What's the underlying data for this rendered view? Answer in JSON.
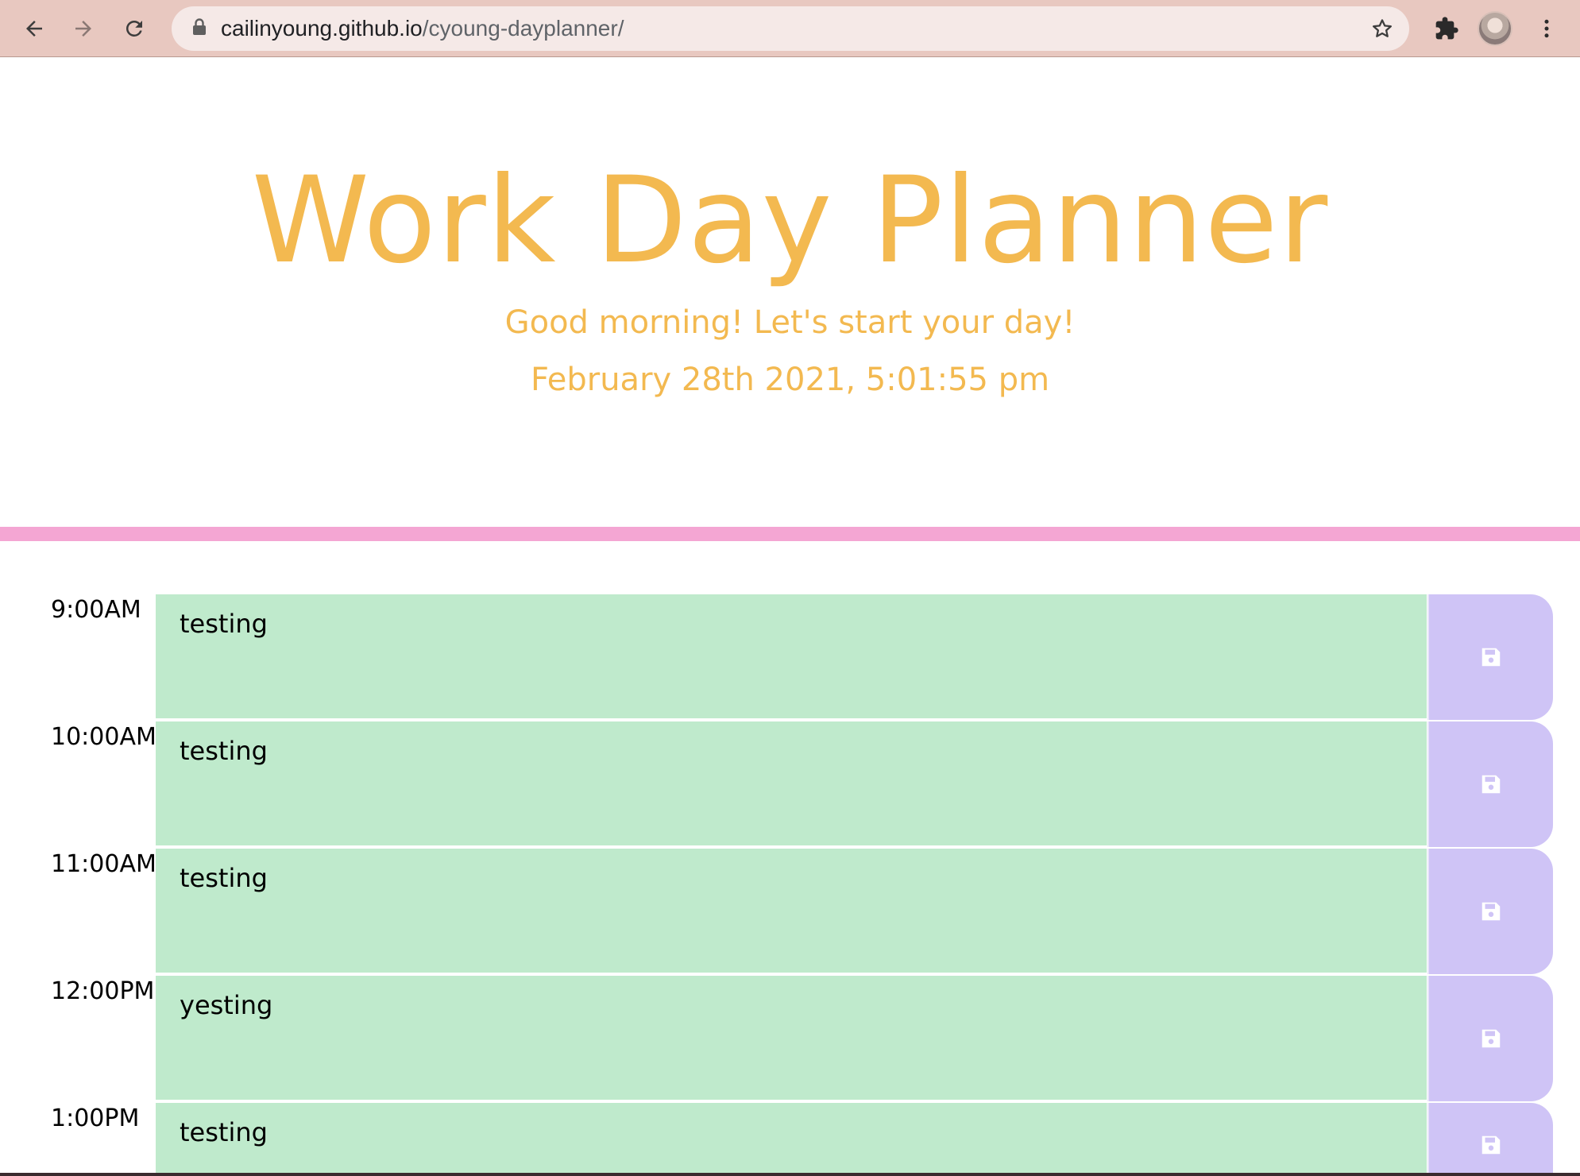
{
  "browser": {
    "url_host": "cailinyoung.github.io",
    "url_path": "/cyoung-dayplanner/",
    "icons": [
      "back-arrow-icon",
      "forward-arrow-icon",
      "reload-icon",
      "lock-icon",
      "star-icon",
      "puzzle-extension-icon",
      "more-vert-icon"
    ]
  },
  "header": {
    "title": "Work Day Planner",
    "greeting": "Good morning! Let's start your day!",
    "datetime": "February 28th 2021, 5:01:55 pm"
  },
  "colors": {
    "title": "#f3b950",
    "divider": "#f4a6d3",
    "future_block": "#bfeacc",
    "save_button": "#cfc4f6",
    "save_icon": "#ffffff"
  },
  "planner": {
    "rows": [
      {
        "hour": "9:00AM",
        "text": "testing"
      },
      {
        "hour": "10:00AM",
        "text": "testing"
      },
      {
        "hour": "11:00AM",
        "text": "testing"
      },
      {
        "hour": "12:00PM",
        "text": "yesting"
      },
      {
        "hour": "1:00PM",
        "text": "testing"
      }
    ]
  }
}
